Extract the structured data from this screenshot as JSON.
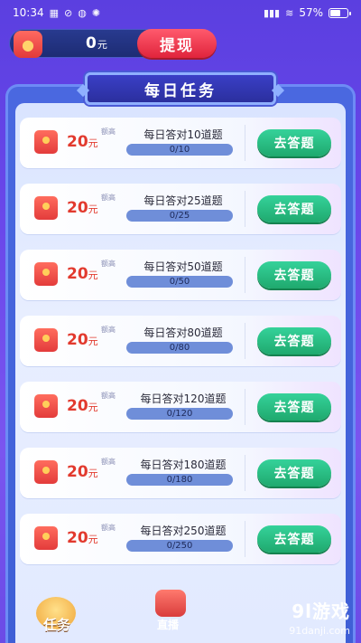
{
  "status_bar": {
    "time": "10:34",
    "left_icons": [
      "sim-icon",
      "link-icon",
      "chat-icon",
      "bug-icon"
    ],
    "right_icons": [
      "signal-speed",
      "wifi-icon"
    ],
    "battery_percent": "57%"
  },
  "header": {
    "balance_value": "0",
    "balance_unit": "元",
    "withdraw_label": "提现"
  },
  "section": {
    "title": "每日任务"
  },
  "tasks": [
    {
      "amount": "20",
      "unit": "元",
      "tag": "额高",
      "title": "每日答对10道题",
      "progress": "0/10",
      "button": "去答题"
    },
    {
      "amount": "20",
      "unit": "元",
      "tag": "额高",
      "title": "每日答对25道题",
      "progress": "0/25",
      "button": "去答题"
    },
    {
      "amount": "20",
      "unit": "元",
      "tag": "额高",
      "title": "每日答对50道题",
      "progress": "0/50",
      "button": "去答题"
    },
    {
      "amount": "20",
      "unit": "元",
      "tag": "额高",
      "title": "每日答对80道题",
      "progress": "0/80",
      "button": "去答题"
    },
    {
      "amount": "20",
      "unit": "元",
      "tag": "额高",
      "title": "每日答对120道题",
      "progress": "0/120",
      "button": "去答题"
    },
    {
      "amount": "20",
      "unit": "元",
      "tag": "额高",
      "title": "每日答对180道题",
      "progress": "0/180",
      "button": "去答题"
    },
    {
      "amount": "20",
      "unit": "元",
      "tag": "额高",
      "title": "每日答对250道题",
      "progress": "0/250",
      "button": "去答题"
    }
  ],
  "bottom_nav": {
    "task_label": "任务",
    "answer_label": "直播"
  },
  "watermark": {
    "brand": "9l游戏",
    "site": "91danji.com"
  },
  "colors": {
    "accent_red": "#e23a2e",
    "button_green": "#1fa96e",
    "withdraw_red": "#e0243c",
    "board_blue": "#4a68e0"
  }
}
